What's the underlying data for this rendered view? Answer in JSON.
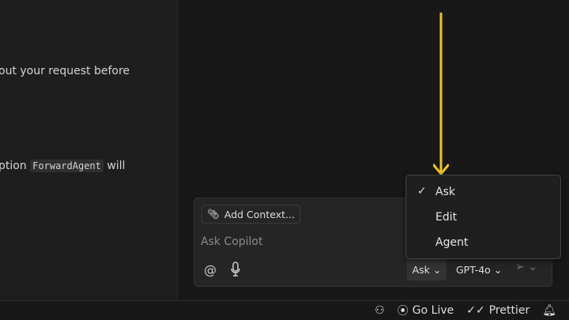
{
  "editor": {
    "line1": "out your request before",
    "line2_pre": "ption",
    "line2_code": "ForwardAgent",
    "line2_post": "will"
  },
  "chat": {
    "add_context": "Add Context...",
    "placeholder": "Ask Copilot",
    "mode": "Ask",
    "model": "GPT-4o"
  },
  "mode_menu": {
    "items": [
      {
        "label": "Ask",
        "checked": true
      },
      {
        "label": "Edit"
      },
      {
        "label": "Agent"
      }
    ]
  },
  "status": {
    "go_live": "Go Live",
    "prettier": "Prettier"
  },
  "colors": {
    "arrow": "#f2c420"
  }
}
